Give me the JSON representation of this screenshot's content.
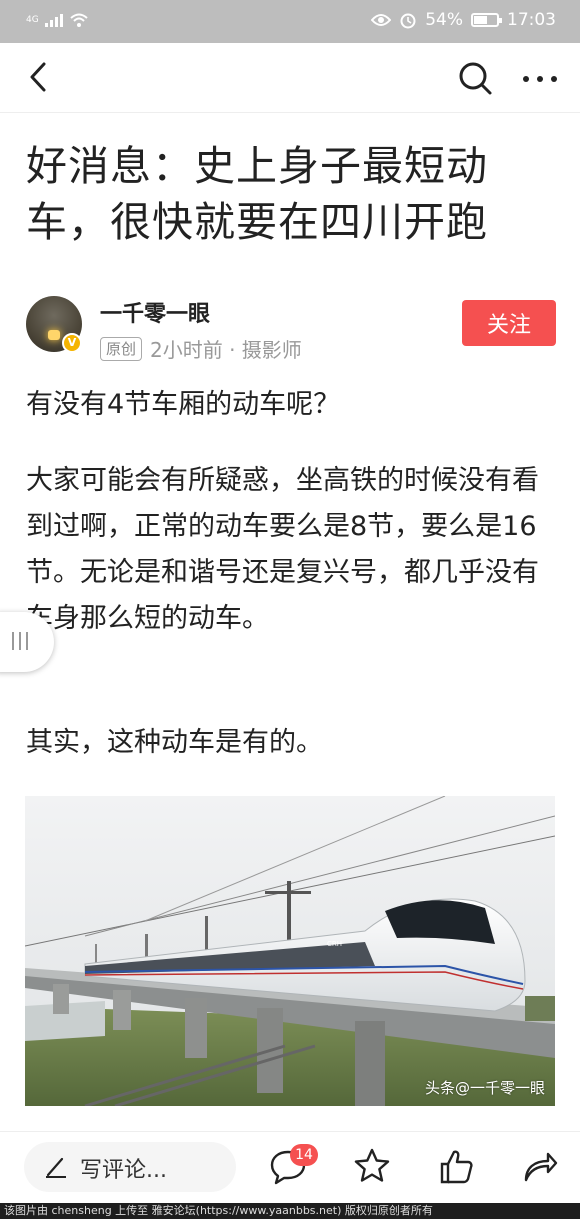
{
  "status_bar": {
    "network": "4G",
    "battery_percent": "54%",
    "time": "17:03"
  },
  "nav": {
    "back_icon": "chevron-left-icon",
    "search_icon": "search-icon",
    "more_icon": "more-horizontal-icon"
  },
  "article": {
    "title": "好消息：史上身子最短动车，很快就要在四川开跑",
    "author": {
      "name": "一千零一眼",
      "original_badge": "原创",
      "meta": "2小时前 · 摄影师",
      "verified_mark": "V"
    },
    "follow_label": "关注",
    "paragraphs": [
      "有没有4节车厢的动车呢？",
      "大家可能会有所疑惑，坐高铁的时候没有看到过啊，正常的动车要么是8节，要么是16节。无论是和谐号还是复兴号，都几乎没有车身那么短的动车。",
      "其实，这种动车是有的。"
    ],
    "image_watermark": "头条@一千零一眼"
  },
  "bottom_bar": {
    "comment_placeholder": "写评论...",
    "comment_count": "14"
  },
  "footer": {
    "credit": "该图片由 chensheng 上传至 雅安论坛(https://www.yaanbbs.net) 版权归原创者所有"
  },
  "colors": {
    "accent": "#f55050",
    "status_bar_bg": "#bdbdbd",
    "text": "#222222",
    "meta_text": "#999999"
  }
}
